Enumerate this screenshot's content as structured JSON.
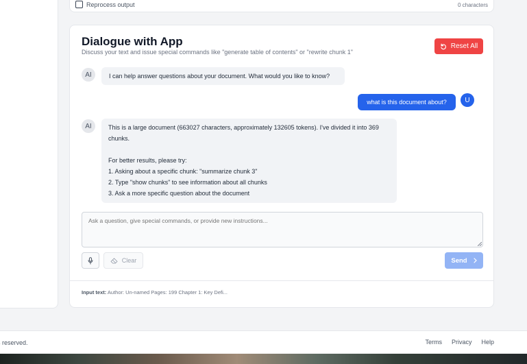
{
  "top_card": {
    "reprocess_label": "Reprocess output",
    "char_count": "0 characters"
  },
  "dialogue": {
    "title": "Dialogue with App",
    "subtitle": "Discuss your text and issue special commands like \"generate table of contents\" or \"rewrite chunk 1\"",
    "reset_label": "Reset All"
  },
  "messages": [
    {
      "role": "ai",
      "avatar": "AI",
      "text": "I can help answer questions about your document. What would you like to know?"
    },
    {
      "role": "user",
      "avatar": "U",
      "text": "what is this document about?"
    },
    {
      "role": "ai",
      "avatar": "AI",
      "text": "This is a large document (663027 characters, approximately 132605 tokens). I've divided it into 369\nchunks.\n\nFor better results, please try:\n1. Asking about a specific chunk: \"summarize chunk 3\"\n2. Type \"show chunks\" to see information about all chunks\n3. Ask a more specific question about the document"
    }
  ],
  "input": {
    "placeholder": "Ask a question, give special commands, or provide new instructions..."
  },
  "buttons": {
    "clear": "Clear",
    "send": "Send"
  },
  "input_info": {
    "label": "Input text:",
    "value": "Author: Un-named Pages: 199 Chapter 1: Key Defi..."
  },
  "footer": {
    "copyright": "s reserved.",
    "links": [
      "Terms",
      "Privacy",
      "Help"
    ]
  },
  "colors": {
    "accent": "#2563eb",
    "danger": "#ef4444",
    "send_disabled": "#93b4f5"
  }
}
